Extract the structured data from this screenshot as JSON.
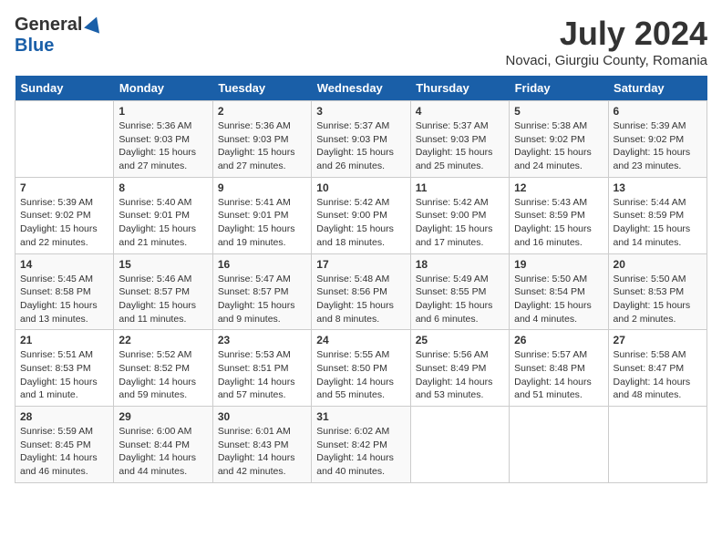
{
  "header": {
    "logo_general": "General",
    "logo_blue": "Blue",
    "month_title": "July 2024",
    "location": "Novaci, Giurgiu County, Romania"
  },
  "days_of_week": [
    "Sunday",
    "Monday",
    "Tuesday",
    "Wednesday",
    "Thursday",
    "Friday",
    "Saturday"
  ],
  "weeks": [
    [
      {
        "num": "",
        "info": ""
      },
      {
        "num": "1",
        "info": "Sunrise: 5:36 AM\nSunset: 9:03 PM\nDaylight: 15 hours\nand 27 minutes."
      },
      {
        "num": "2",
        "info": "Sunrise: 5:36 AM\nSunset: 9:03 PM\nDaylight: 15 hours\nand 27 minutes."
      },
      {
        "num": "3",
        "info": "Sunrise: 5:37 AM\nSunset: 9:03 PM\nDaylight: 15 hours\nand 26 minutes."
      },
      {
        "num": "4",
        "info": "Sunrise: 5:37 AM\nSunset: 9:03 PM\nDaylight: 15 hours\nand 25 minutes."
      },
      {
        "num": "5",
        "info": "Sunrise: 5:38 AM\nSunset: 9:02 PM\nDaylight: 15 hours\nand 24 minutes."
      },
      {
        "num": "6",
        "info": "Sunrise: 5:39 AM\nSunset: 9:02 PM\nDaylight: 15 hours\nand 23 minutes."
      }
    ],
    [
      {
        "num": "7",
        "info": "Sunrise: 5:39 AM\nSunset: 9:02 PM\nDaylight: 15 hours\nand 22 minutes."
      },
      {
        "num": "8",
        "info": "Sunrise: 5:40 AM\nSunset: 9:01 PM\nDaylight: 15 hours\nand 21 minutes."
      },
      {
        "num": "9",
        "info": "Sunrise: 5:41 AM\nSunset: 9:01 PM\nDaylight: 15 hours\nand 19 minutes."
      },
      {
        "num": "10",
        "info": "Sunrise: 5:42 AM\nSunset: 9:00 PM\nDaylight: 15 hours\nand 18 minutes."
      },
      {
        "num": "11",
        "info": "Sunrise: 5:42 AM\nSunset: 9:00 PM\nDaylight: 15 hours\nand 17 minutes."
      },
      {
        "num": "12",
        "info": "Sunrise: 5:43 AM\nSunset: 8:59 PM\nDaylight: 15 hours\nand 16 minutes."
      },
      {
        "num": "13",
        "info": "Sunrise: 5:44 AM\nSunset: 8:59 PM\nDaylight: 15 hours\nand 14 minutes."
      }
    ],
    [
      {
        "num": "14",
        "info": "Sunrise: 5:45 AM\nSunset: 8:58 PM\nDaylight: 15 hours\nand 13 minutes."
      },
      {
        "num": "15",
        "info": "Sunrise: 5:46 AM\nSunset: 8:57 PM\nDaylight: 15 hours\nand 11 minutes."
      },
      {
        "num": "16",
        "info": "Sunrise: 5:47 AM\nSunset: 8:57 PM\nDaylight: 15 hours\nand 9 minutes."
      },
      {
        "num": "17",
        "info": "Sunrise: 5:48 AM\nSunset: 8:56 PM\nDaylight: 15 hours\nand 8 minutes."
      },
      {
        "num": "18",
        "info": "Sunrise: 5:49 AM\nSunset: 8:55 PM\nDaylight: 15 hours\nand 6 minutes."
      },
      {
        "num": "19",
        "info": "Sunrise: 5:50 AM\nSunset: 8:54 PM\nDaylight: 15 hours\nand 4 minutes."
      },
      {
        "num": "20",
        "info": "Sunrise: 5:50 AM\nSunset: 8:53 PM\nDaylight: 15 hours\nand 2 minutes."
      }
    ],
    [
      {
        "num": "21",
        "info": "Sunrise: 5:51 AM\nSunset: 8:53 PM\nDaylight: 15 hours\nand 1 minute."
      },
      {
        "num": "22",
        "info": "Sunrise: 5:52 AM\nSunset: 8:52 PM\nDaylight: 14 hours\nand 59 minutes."
      },
      {
        "num": "23",
        "info": "Sunrise: 5:53 AM\nSunset: 8:51 PM\nDaylight: 14 hours\nand 57 minutes."
      },
      {
        "num": "24",
        "info": "Sunrise: 5:55 AM\nSunset: 8:50 PM\nDaylight: 14 hours\nand 55 minutes."
      },
      {
        "num": "25",
        "info": "Sunrise: 5:56 AM\nSunset: 8:49 PM\nDaylight: 14 hours\nand 53 minutes."
      },
      {
        "num": "26",
        "info": "Sunrise: 5:57 AM\nSunset: 8:48 PM\nDaylight: 14 hours\nand 51 minutes."
      },
      {
        "num": "27",
        "info": "Sunrise: 5:58 AM\nSunset: 8:47 PM\nDaylight: 14 hours\nand 48 minutes."
      }
    ],
    [
      {
        "num": "28",
        "info": "Sunrise: 5:59 AM\nSunset: 8:45 PM\nDaylight: 14 hours\nand 46 minutes."
      },
      {
        "num": "29",
        "info": "Sunrise: 6:00 AM\nSunset: 8:44 PM\nDaylight: 14 hours\nand 44 minutes."
      },
      {
        "num": "30",
        "info": "Sunrise: 6:01 AM\nSunset: 8:43 PM\nDaylight: 14 hours\nand 42 minutes."
      },
      {
        "num": "31",
        "info": "Sunrise: 6:02 AM\nSunset: 8:42 PM\nDaylight: 14 hours\nand 40 minutes."
      },
      {
        "num": "",
        "info": ""
      },
      {
        "num": "",
        "info": ""
      },
      {
        "num": "",
        "info": ""
      }
    ]
  ]
}
